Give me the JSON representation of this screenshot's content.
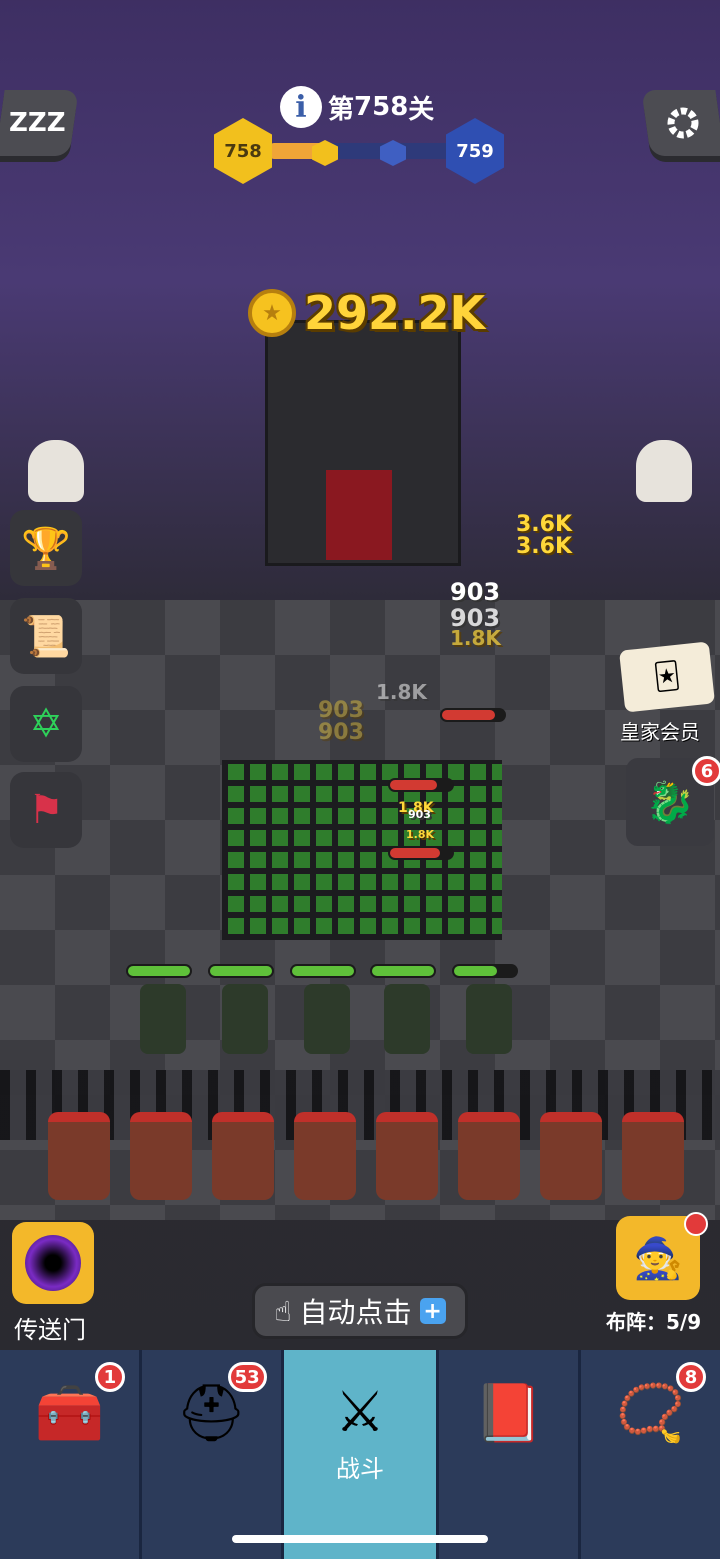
{
  "header": {
    "level_prefix": "第",
    "level_number": "758",
    "level_suffix": "关",
    "current_level": "758",
    "next_level": "759",
    "progress_fraction": 0.3,
    "sleep_icon": "ZZZ"
  },
  "coins": {
    "value": "292.2K"
  },
  "battle": {
    "damage_numbers": [
      "3.6K",
      "3.6K",
      "903",
      "903",
      "1.8K",
      "1.8K",
      "903",
      "903",
      "1.8K",
      "903",
      "1.8K"
    ],
    "ally_hp_fractions": [
      1.0,
      1.0,
      1.0,
      1.0,
      0.7
    ],
    "enemy_hp_fractions": [
      0.85,
      0.75,
      0.8
    ]
  },
  "side": {
    "vip_label": "皇家会员",
    "dragon_badge": "6"
  },
  "bottom": {
    "portal_label": "传送门",
    "auto_click_label": "自动点击",
    "formation_label": "布阵：",
    "formation_value": "5/9"
  },
  "nav": {
    "items": [
      {
        "icon": "treasure-chest-icon",
        "badge": "1",
        "label": ""
      },
      {
        "icon": "viking-helmet-icon",
        "badge": "53",
        "label": ""
      },
      {
        "icon": "crossed-swords-icon",
        "badge": "",
        "label": "战斗"
      },
      {
        "icon": "spell-book-icon",
        "badge": "",
        "label": ""
      },
      {
        "icon": "amulet-icon",
        "badge": "8",
        "label": ""
      }
    ]
  },
  "colors": {
    "accent_gold": "#f6c21f",
    "nav_active": "#5fb4c9",
    "badge_red": "#e23a3a",
    "hp_green": "#5fc13a",
    "hp_red": "#d23a32"
  }
}
